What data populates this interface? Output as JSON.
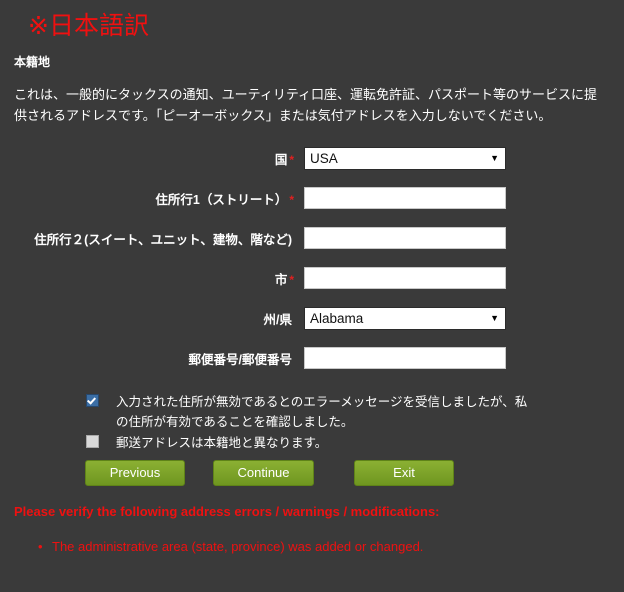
{
  "page": {
    "translation_heading": "※日本語訳",
    "section_heading": "本籍地",
    "description": "これは、一般的にタックスの通知、ユーティリティ口座、運転免許証、パスポート等のサービスに提供されるアドレスです。「ピーオーボックス」または気付アドレスを入力しないでください。",
    "background_color": "#3a3a3a",
    "accent_red": "#ee1111",
    "button_green": "#7da52a"
  },
  "form": {
    "fields": [
      {
        "label": "国",
        "required": true,
        "required_marker": "*",
        "type": "select",
        "value": "USA",
        "arrow": "▼"
      },
      {
        "label": "住所行1（ストリート）",
        "required": true,
        "required_marker": "*",
        "type": "text",
        "value": "",
        "placeholder": ""
      },
      {
        "label": "住所行２(スイート、ユニット、建物、階など)",
        "required": false,
        "required_marker": "",
        "type": "text",
        "value": "",
        "placeholder": ""
      },
      {
        "label": "市",
        "required": true,
        "required_marker": "*",
        "type": "text",
        "value": "",
        "placeholder": ""
      },
      {
        "label": "州/県",
        "required": false,
        "required_marker": "",
        "type": "select",
        "value": "Alabama",
        "arrow": "▼"
      },
      {
        "label": "郵便番号/郵便番号",
        "required": false,
        "required_marker": "",
        "type": "text",
        "value": "",
        "placeholder": ""
      }
    ]
  },
  "checkboxes": [
    {
      "checked": true,
      "label": "入力された住所が無効であるとのエラーメッセージを受信しましたが、私の住所が有効であることを確認しました。"
    },
    {
      "checked": false,
      "label": "郵送アドレスは本籍地と異なります。"
    }
  ],
  "buttons": {
    "previous": "Previous",
    "continue": "Continue",
    "exit": "Exit"
  },
  "errors": {
    "title": "Please verify the following address errors / warnings / modifications:",
    "items": [
      "The administrative area (state, province) was added or changed."
    ]
  }
}
